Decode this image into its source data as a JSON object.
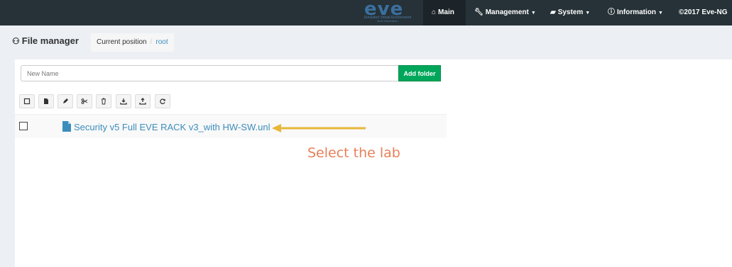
{
  "brand": {
    "logo_text": "eve",
    "tagline_1": "Emulated Virtual Environment",
    "tagline_2": "Next Generation"
  },
  "navbar": {
    "items": [
      {
        "label": "Main",
        "icon": "home-icon"
      },
      {
        "label": "Management",
        "icon": "wrench-icon"
      },
      {
        "label": "System",
        "icon": "book-icon"
      },
      {
        "label": "Information",
        "icon": "info-circle-icon"
      }
    ],
    "copyright": "©2017 Eve-NG"
  },
  "header": {
    "title": "File manager",
    "title_icon": "sitemap-icon",
    "breadcrumb": {
      "label": "Current position",
      "separator": "/",
      "root": "root"
    }
  },
  "new_folder": {
    "placeholder": "New Name",
    "value": "",
    "add_label": "Add folder"
  },
  "toolbar": {
    "buttons": [
      "select-all",
      "new-file",
      "edit",
      "cut",
      "delete",
      "import",
      "export",
      "refresh"
    ]
  },
  "files": [
    {
      "name": "Security v5 Full EVE RACK v3_with HW-SW.unl",
      "checked": false
    }
  ],
  "annotation": {
    "text": "Select the lab",
    "color": "#e8805a"
  },
  "colors": {
    "navbar": "#263238",
    "link": "#3c8dbc",
    "success": "#00a65a",
    "arrow": "#e8b63a"
  }
}
